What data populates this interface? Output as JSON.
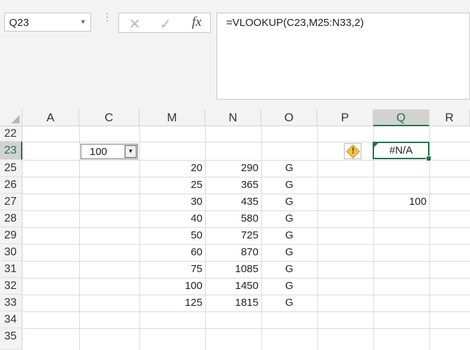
{
  "name_box": {
    "value": "Q23"
  },
  "formula_bar": {
    "cancel_glyph": "✕",
    "enter_glyph": "✓",
    "fx_label": "fx",
    "formula": "=VLOOKUP(C23,M25:N33,2)"
  },
  "columns": [
    "A",
    "C",
    "M",
    "N",
    "O",
    "P",
    "Q",
    "R"
  ],
  "selected_column": "Q",
  "rows": [
    "22",
    "23",
    "25",
    "26",
    "27",
    "28",
    "29",
    "30",
    "31",
    "32",
    "33",
    "34",
    "35"
  ],
  "selected_row": "23",
  "dropdown": {
    "value": "100"
  },
  "active_cell": {
    "ref": "Q23",
    "value": "#N/A"
  },
  "lookup_value_q27": "100",
  "table": [
    {
      "m": "20",
      "n": "290",
      "o": "G"
    },
    {
      "m": "25",
      "n": "365",
      "o": "G"
    },
    {
      "m": "30",
      "n": "435",
      "o": "G"
    },
    {
      "m": "40",
      "n": "580",
      "o": "G"
    },
    {
      "m": "50",
      "n": "725",
      "o": "G"
    },
    {
      "m": "60",
      "n": "870",
      "o": "G"
    },
    {
      "m": "75",
      "n": "1085",
      "o": "G"
    },
    {
      "m": "100",
      "n": "1450",
      "o": "G"
    },
    {
      "m": "125",
      "n": "1815",
      "o": "G"
    }
  ],
  "colors": {
    "accent": "#217346",
    "warning": "#f2c14e"
  },
  "icons": [
    "chevron-down-icon",
    "cancel-icon",
    "check-icon",
    "fx-icon",
    "warning-icon"
  ]
}
